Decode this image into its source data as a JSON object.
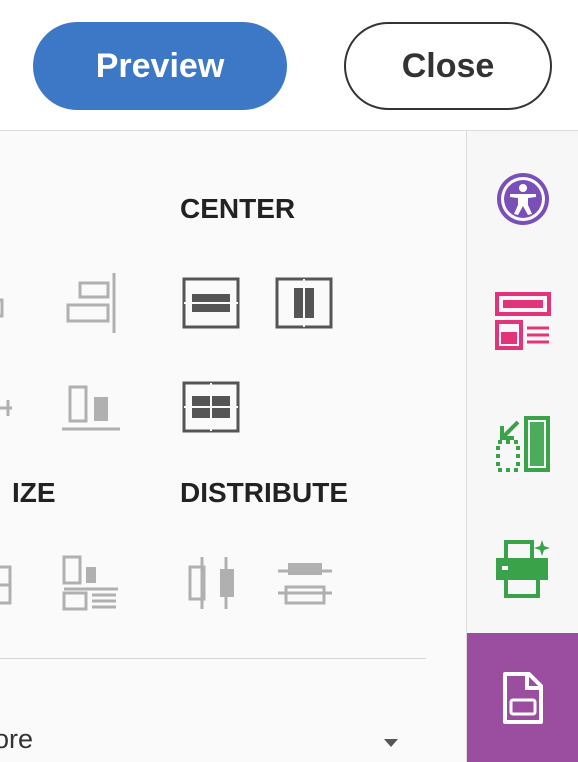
{
  "header": {
    "preview_label": "Preview",
    "close_label": "Close"
  },
  "align_panel": {
    "center_heading": "CENTER",
    "size_heading_partial": "IZE",
    "distribute_heading": "DISTRIBUTE",
    "more_label_partial": "ore"
  },
  "right_rail": {
    "items": [
      "accessibility-icon",
      "edit-layout-icon",
      "export-pages-icon",
      "print-production-icon",
      "document-icon"
    ],
    "active_color": "#9b4ea0"
  },
  "colors": {
    "primary": "#3d78c6",
    "accessibility": "#7b4fb8",
    "layout": "#e2347a",
    "green": "#3aa34a"
  }
}
